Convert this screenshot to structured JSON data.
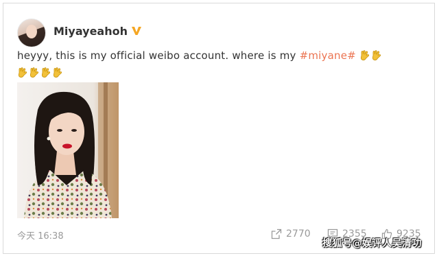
{
  "post": {
    "username": "Miyayeahoh",
    "verified_icon": "verified-badge-icon",
    "text_before": "heyyy, this is my official weibo account. where is my ",
    "hashtag": "#miyane#",
    "emoji_icon": "hand-gesture-icon",
    "emoji_count_line1": 2,
    "emoji_count_line2": 4,
    "time": "今天 16:38"
  },
  "actions": {
    "share_count": "2770",
    "comment_count": "2355",
    "like_count": "9235"
  },
  "watermark": "搜狐号@娱评人吴清功",
  "colors": {
    "hashtag": "#eb7350",
    "verified": "#f5a623",
    "muted": "#999999"
  }
}
